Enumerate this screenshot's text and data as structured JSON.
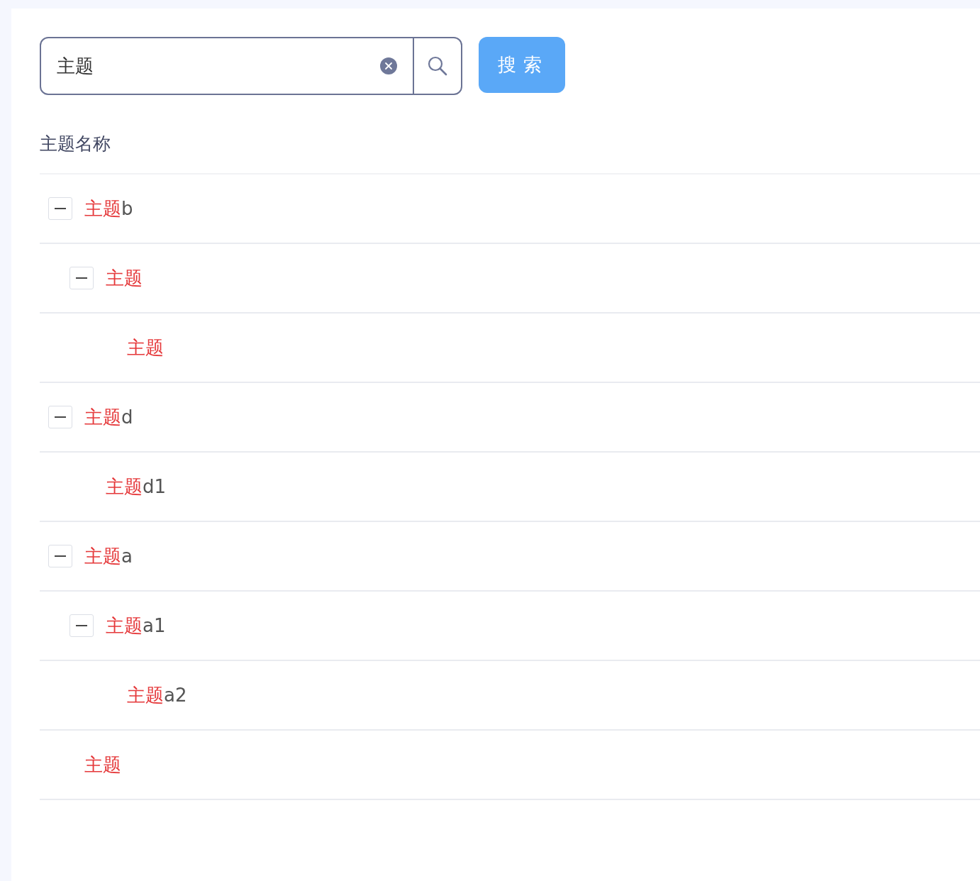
{
  "search": {
    "value": "主题",
    "button": "搜索"
  },
  "table": {
    "header": "主题名称",
    "rows": [
      {
        "highlight": "主题",
        "rest": "b",
        "expanded": true,
        "children": [
          {
            "highlight": "主题",
            "expanded": true,
            "children": [
              {
                "highlight": "主题"
              }
            ]
          }
        ]
      },
      {
        "highlight": "主题",
        "rest": "d",
        "expanded": true,
        "children": [
          {
            "highlight": "主题",
            "rest": "d1"
          }
        ]
      },
      {
        "highlight": "主题",
        "rest": "a",
        "expanded": true,
        "children": [
          {
            "highlight": "主题",
            "rest": "a1",
            "expanded": true,
            "children": [
              {
                "highlight": "主题",
                "rest": "a2"
              }
            ]
          }
        ]
      },
      {
        "highlight": "主题"
      }
    ]
  }
}
